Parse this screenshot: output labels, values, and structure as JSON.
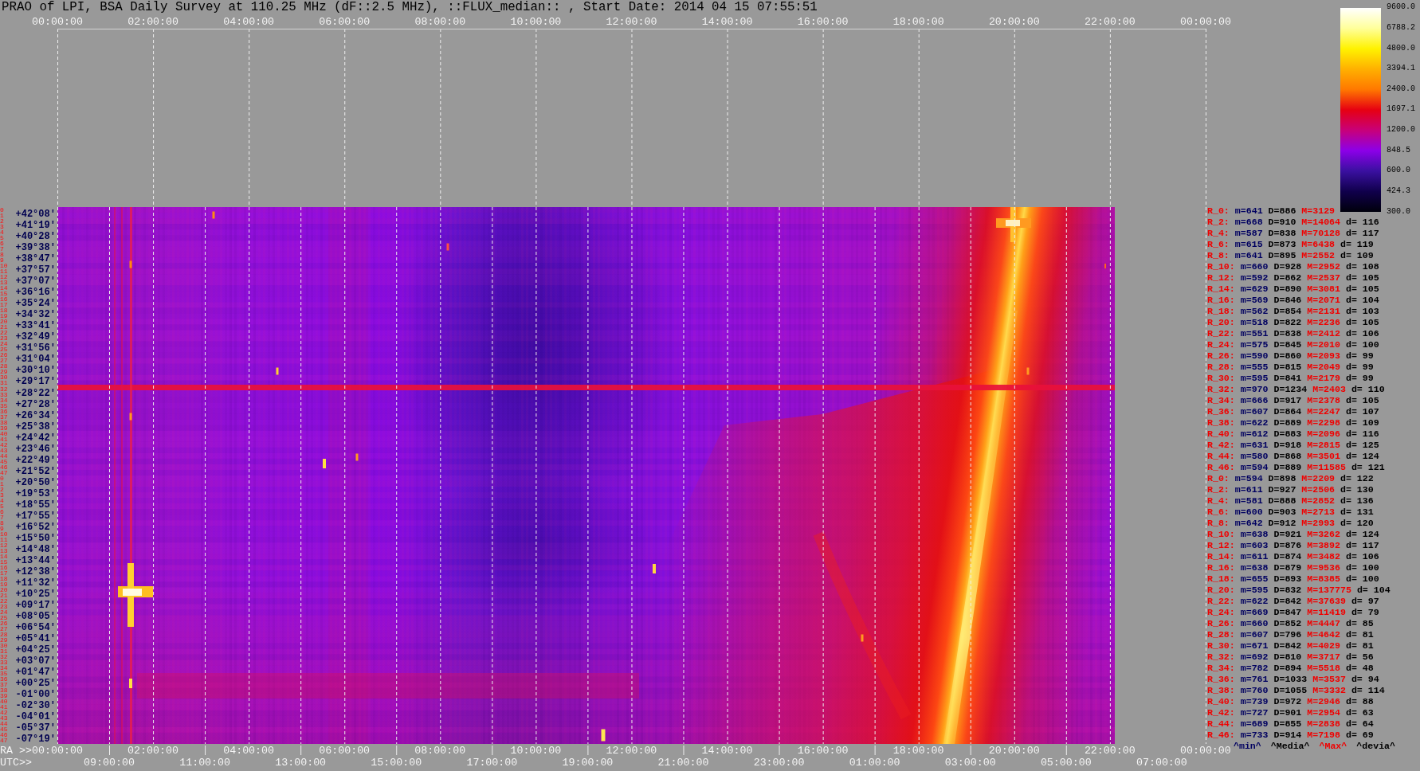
{
  "title": "PRAO of LPI, BSA Daily Survey at 110.25 MHz (dF::2.5 MHz), ::FLUX_median:: , Start Date: 2014 04 15 07:55:51",
  "top_axis": {
    "ticks": [
      "00:00:00",
      "02:00:00",
      "04:00:00",
      "06:00:00",
      "08:00:00",
      "10:00:00",
      "12:00:00",
      "14:00:00",
      "16:00:00",
      "18:00:00",
      "20:00:00",
      "22:00:00",
      "00:00:00"
    ]
  },
  "color_scale": {
    "labels": [
      "9600.0",
      "6788.2",
      "4800.0",
      "3394.1",
      "2400.0",
      "1697.1",
      "1200.0",
      "848.5",
      "600.0",
      "424.3",
      "300.0"
    ]
  },
  "row_numbers": [
    "0",
    "1",
    "2",
    "3",
    "4",
    "5",
    "6",
    "7",
    "8",
    "9",
    "10",
    "11",
    "12",
    "13",
    "14",
    "15",
    "16",
    "17",
    "18",
    "19",
    "20",
    "21",
    "22",
    "23",
    "24",
    "25",
    "26",
    "27",
    "28",
    "29",
    "30",
    "31",
    "32",
    "33",
    "34",
    "35",
    "36",
    "37",
    "38",
    "39",
    "40",
    "41",
    "42",
    "43",
    "44",
    "45",
    "46",
    "47",
    "0",
    "1",
    "2",
    "3",
    "4",
    "5",
    "6",
    "7",
    "8",
    "9",
    "10",
    "11",
    "12",
    "13",
    "14",
    "15",
    "16",
    "17",
    "18",
    "19",
    "20",
    "21",
    "22",
    "23",
    "24",
    "25",
    "26",
    "27",
    "28",
    "29",
    "30",
    "31",
    "32",
    "33",
    "34",
    "35",
    "36",
    "37",
    "38",
    "39",
    "40",
    "41",
    "42",
    "43",
    "44",
    "45",
    "46",
    "47"
  ],
  "declinations": [
    "+42°08'",
    "+41°19'",
    "+40°28'",
    "+39°38'",
    "+38°47'",
    "+37°57'",
    "+37°07'",
    "+36°16'",
    "+35°24'",
    "+34°32'",
    "+33°41'",
    "+32°49'",
    "+31°56'",
    "+31°04'",
    "+30°10'",
    "+29°17'",
    "+28°22'",
    "+27°28'",
    "+26°34'",
    "+25°38'",
    "+24°42'",
    "+23°46'",
    "+22°49'",
    "+21°52'",
    "+20°50'",
    "+19°53'",
    "+18°55'",
    "+17°55'",
    "+16°52'",
    "+15°50'",
    "+14°48'",
    "+13°44'",
    "+12°38'",
    "+11°32'",
    "+10°25'",
    "+09°17'",
    "+08°05'",
    "+06°54'",
    "+05°41'",
    "+04°25'",
    "+03°07'",
    "+01°47'",
    "+00°25'",
    "-01°00'",
    "-02°30'",
    "-04°01'",
    "-05°37'",
    "-07°19'"
  ],
  "stats": [
    {
      "label": "R_0:",
      "min": "m=641",
      "median": "D=886",
      "max": "M=3129"
    },
    {
      "label": "R_2:",
      "min": "m=668",
      "median": "D=910",
      "max": "M=14064",
      "deviation": "d= 116"
    },
    {
      "label": "R_4:",
      "min": "m=587",
      "median": "D=838",
      "max": "M=70128",
      "deviation": "d= 117"
    },
    {
      "label": "R_6:",
      "min": "m=615",
      "median": "D=873",
      "max": "M=6438",
      "deviation": "d= 119"
    },
    {
      "label": "R_8:",
      "min": "m=641",
      "median": "D=895",
      "max": "M=2552",
      "deviation": "d= 109"
    },
    {
      "label": "R_10:",
      "min": "m=660",
      "median": "D=928",
      "max": "M=2952",
      "deviation": "d= 108"
    },
    {
      "label": "R_12:",
      "min": "m=592",
      "median": "D=862",
      "max": "M=2537",
      "deviation": "d= 105"
    },
    {
      "label": "R_14:",
      "min": "m=629",
      "median": "D=890",
      "max": "M=3081",
      "deviation": "d= 105"
    },
    {
      "label": "R_16:",
      "min": "m=569",
      "median": "D=846",
      "max": "M=2071",
      "deviation": "d= 104"
    },
    {
      "label": "R_18:",
      "min": "m=562",
      "median": "D=854",
      "max": "M=2131",
      "deviation": "d= 103"
    },
    {
      "label": "R_20:",
      "min": "m=518",
      "median": "D=822",
      "max": "M=2236",
      "deviation": "d= 105"
    },
    {
      "label": "R_22:",
      "min": "m=551",
      "median": "D=838",
      "max": "M=2412",
      "deviation": "d= 106"
    },
    {
      "label": "R_24:",
      "min": "m=575",
      "median": "D=845",
      "max": "M=2010",
      "deviation": "d= 100"
    },
    {
      "label": "R_26:",
      "min": "m=590",
      "median": "D=860",
      "max": "M=2093",
      "deviation": "d= 99"
    },
    {
      "label": "R_28:",
      "min": "m=555",
      "median": "D=815",
      "max": "M=2049",
      "deviation": "d= 99"
    },
    {
      "label": "R_30:",
      "min": "m=595",
      "median": "D=841",
      "max": "M=2179",
      "deviation": "d= 99"
    },
    {
      "label": "R_32:",
      "min": "m=970",
      "median": "D=1234",
      "max": "M=2403",
      "deviation": "d= 110"
    },
    {
      "label": "R_34:",
      "min": "m=666",
      "median": "D=917",
      "max": "M=2378",
      "deviation": "d= 105"
    },
    {
      "label": "R_36:",
      "min": "m=607",
      "median": "D=864",
      "max": "M=2247",
      "deviation": "d= 107"
    },
    {
      "label": "R_38:",
      "min": "m=622",
      "median": "D=889",
      "max": "M=2298",
      "deviation": "d= 109"
    },
    {
      "label": "R_40:",
      "min": "m=612",
      "median": "D=883",
      "max": "M=2096",
      "deviation": "d= 116"
    },
    {
      "label": "R_42:",
      "min": "m=631",
      "median": "D=918",
      "max": "M=2815",
      "deviation": "d= 125"
    },
    {
      "label": "R_44:",
      "min": "m=580",
      "median": "D=868",
      "max": "M=3501",
      "deviation": "d= 124"
    },
    {
      "label": "R_46:",
      "min": "m=594",
      "median": "D=889",
      "max": "M=11585",
      "deviation": "d= 121"
    },
    {
      "label": "R_0:",
      "min": "m=594",
      "median": "D=898",
      "max": "M=2209",
      "deviation": "d= 122"
    },
    {
      "label": "R_2:",
      "min": "m=611",
      "median": "D=927",
      "max": "M=2506",
      "deviation": "d= 130"
    },
    {
      "label": "R_4:",
      "min": "m=581",
      "median": "D=888",
      "max": "M=2852",
      "deviation": "d= 136"
    },
    {
      "label": "R_6:",
      "min": "m=600",
      "median": "D=903",
      "max": "M=2713",
      "deviation": "d= 131"
    },
    {
      "label": "R_8:",
      "min": "m=642",
      "median": "D=912",
      "max": "M=2993",
      "deviation": "d= 120"
    },
    {
      "label": "R_10:",
      "min": "m=638",
      "median": "D=921",
      "max": "M=3262",
      "deviation": "d= 124"
    },
    {
      "label": "R_12:",
      "min": "m=603",
      "median": "D=876",
      "max": "M=3892",
      "deviation": "d= 117"
    },
    {
      "label": "R_14:",
      "min": "m=611",
      "median": "D=874",
      "max": "M=3482",
      "deviation": "d= 106"
    },
    {
      "label": "R_16:",
      "min": "m=638",
      "median": "D=879",
      "max": "M=9536",
      "deviation": "d= 100"
    },
    {
      "label": "R_18:",
      "min": "m=655",
      "median": "D=893",
      "max": "M=8385",
      "deviation": "d= 100"
    },
    {
      "label": "R_20:",
      "min": "m=595",
      "median": "D=832",
      "max": "M=137775",
      "deviation": "d= 104"
    },
    {
      "label": "R_22:",
      "min": "m=622",
      "median": "D=842",
      "max": "M=37639",
      "deviation": "d= 97"
    },
    {
      "label": "R_24:",
      "min": "m=669",
      "median": "D=847",
      "max": "M=11419",
      "deviation": "d= 79"
    },
    {
      "label": "R_26:",
      "min": "m=660",
      "median": "D=852",
      "max": "M=4447",
      "deviation": "d= 85"
    },
    {
      "label": "R_28:",
      "min": "m=607",
      "median": "D=796",
      "max": "M=4642",
      "deviation": "d= 81"
    },
    {
      "label": "R_30:",
      "min": "m=671",
      "median": "D=842",
      "max": "M=4029",
      "deviation": "d= 81"
    },
    {
      "label": "R_32:",
      "min": "m=692",
      "median": "D=810",
      "max": "M=3717",
      "deviation": "d= 56"
    },
    {
      "label": "R_34:",
      "min": "m=782",
      "median": "D=894",
      "max": "M=5518",
      "deviation": "d= 48"
    },
    {
      "label": "R_36:",
      "min": "m=761",
      "median": "D=1033",
      "max": "M=3537",
      "deviation": "d= 94"
    },
    {
      "label": "R_38:",
      "min": "m=760",
      "median": "D=1055",
      "max": "M=3332",
      "deviation": "d= 114"
    },
    {
      "label": "R_40:",
      "min": "m=739",
      "median": "D=972",
      "max": "M=2946",
      "deviation": "d= 88"
    },
    {
      "label": "R_42:",
      "min": "m=727",
      "median": "D=901",
      "max": "M=2954",
      "deviation": "d= 63"
    },
    {
      "label": "R_44:",
      "min": "m=689",
      "median": "D=855",
      "max": "M=2838",
      "deviation": "d= 64"
    },
    {
      "label": "R_46:",
      "min": "m=733",
      "median": "D=914",
      "max": "M=7198",
      "deviation": "d= 69"
    }
  ],
  "stats_legend": [
    {
      "kind": "min",
      "text": "^min^"
    },
    {
      "kind": "median",
      "text": "^Media^"
    },
    {
      "kind": "max",
      "text": "^Max^"
    },
    {
      "kind": "deviation",
      "text": "^devia^"
    }
  ],
  "bottom_axis": {
    "ra_title": "RA >>",
    "ra_ticks": [
      "00:00:00",
      "02:00:00",
      "04:00:00",
      "06:00:00",
      "08:00:00",
      "10:00:00",
      "12:00:00",
      "14:00:00",
      "16:00:00",
      "18:00:00",
      "20:00:00",
      "22:00:00",
      "00:00:00"
    ],
    "utc_title": "UTC>>",
    "utc_ticks": [
      "09:00:00",
      "11:00:00",
      "13:00:00",
      "15:00:00",
      "17:00:00",
      "19:00:00",
      "21:00:00",
      "23:00:00",
      "01:00:00",
      "03:00:00",
      "05:00:00",
      "07:00:00"
    ]
  }
}
